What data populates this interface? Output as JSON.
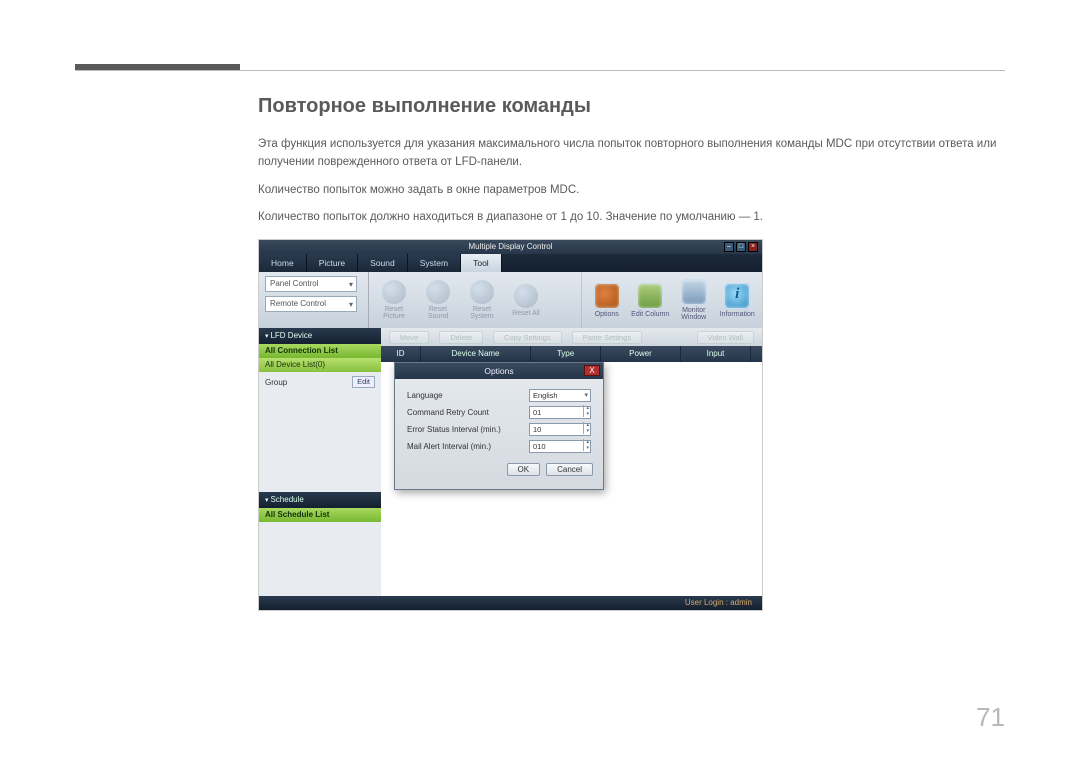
{
  "section": {
    "title": "Повторное выполнение команды",
    "p1": "Эта функция используется для указания максимального числа попыток повторного выполнения команды MDC при отсутствии ответа или получении поврежденного ответа от LFD-панели.",
    "p2": "Количество попыток можно задать в окне параметров MDC.",
    "p3": "Количество попыток должно находиться в диапазоне от 1 до 10. Значение по умолчанию — 1."
  },
  "app": {
    "title": "Multiple Display Control",
    "tabs": [
      "Home",
      "Picture",
      "Sound",
      "System",
      "Tool"
    ],
    "active_tab": 4,
    "panel": {
      "combo1": "Panel Control",
      "combo2": "Remote Control",
      "resets": [
        "Reset Picture",
        "Reset Sound",
        "Reset System",
        "Reset All"
      ],
      "right": [
        {
          "key": "opt",
          "label": "Options"
        },
        {
          "key": "ec",
          "label": "Edit Column"
        },
        {
          "key": "mw",
          "label": "Monitor Window"
        },
        {
          "key": "info",
          "label": "Information"
        }
      ]
    },
    "sidebar": {
      "lfd_header": "LFD Device",
      "conn": "All Connection List",
      "devlist": "All Device List(0)",
      "group": "Group",
      "edit": "Edit",
      "sched_header": "Schedule",
      "schedlist": "All Schedule List"
    },
    "toolbar": {
      "b1": "Move",
      "b2": "Delete",
      "b3": "Copy Settings",
      "b4": "Paste Settings",
      "b5": "Video Wall"
    },
    "columns": [
      "ID",
      "Device Name",
      "Type",
      "Power",
      "Input"
    ],
    "dialog": {
      "title": "Options",
      "rows": [
        {
          "label": "Language",
          "value": "English",
          "type": "select"
        },
        {
          "label": "Command Retry Count",
          "value": "01",
          "type": "spin"
        },
        {
          "label": "Error Status Interval (min.)",
          "value": "10",
          "type": "spin"
        },
        {
          "label": "Mail Alert Interval (min.)",
          "value": "010",
          "type": "spin"
        }
      ],
      "ok": "OK",
      "cancel": "Cancel"
    },
    "status": "User Login : admin"
  },
  "page_number": "71"
}
